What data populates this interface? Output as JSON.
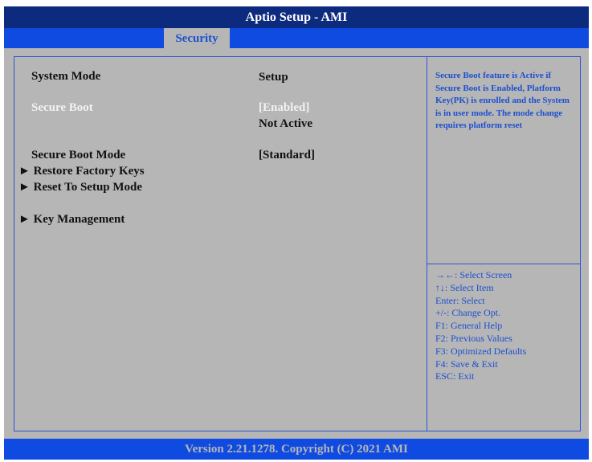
{
  "title": "Aptio Setup  - AMI",
  "tab": "Security",
  "items": [
    {
      "label": "System Mode",
      "value": "Setup"
    },
    {
      "label": "Secure Boot",
      "value": "[Enabled]",
      "value2": "Not Active"
    },
    {
      "label": "Secure Boot Mode",
      "value": "[Standard]"
    },
    {
      "label": "Restore Factory Keys"
    },
    {
      "label": "Reset To Setup Mode"
    },
    {
      "label": "Key Management"
    }
  ],
  "submenu_arrow": "►",
  "help_text": "Secure Boot feature is Active if Secure Boot is Enabled, Platform Key(PK) is enrolled and the System is in user mode. The mode change requires platform reset",
  "keys": [
    "→←: Select Screen",
    "↑↓: Select Item",
    "Enter: Select",
    "+/-: Change Opt.",
    "F1: General Help",
    "F2: Previous Values",
    "F3: Optimized Defaults",
    "F4: Save & Exit",
    "ESC: Exit"
  ],
  "footer": "Version 2.21.1278. Copyright (C) 2021 AMI",
  "colors": {
    "title_bg": "#0c2a7e",
    "bar_bg": "#0f4be0",
    "panel_bg": "#b6b6b6",
    "accent": "#1c4fcf"
  }
}
